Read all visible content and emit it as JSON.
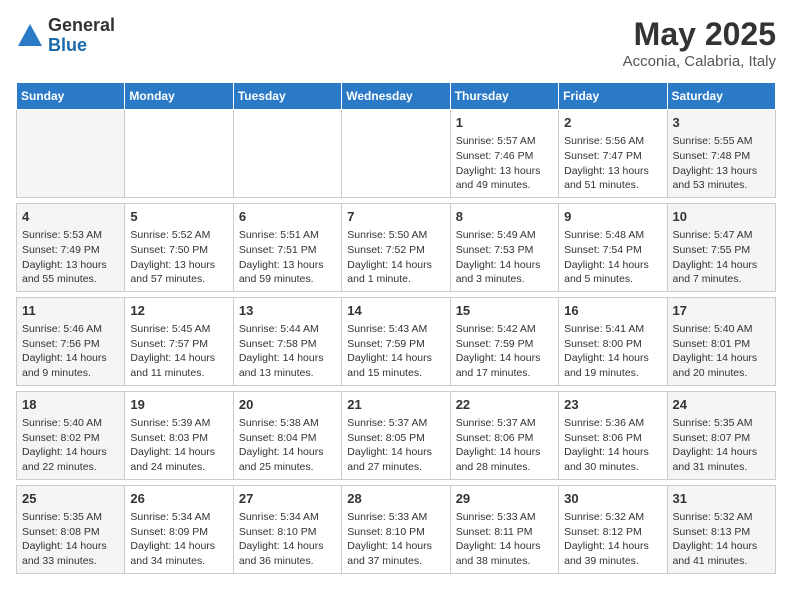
{
  "logo": {
    "general": "General",
    "blue": "Blue"
  },
  "title": "May 2025",
  "subtitle": "Acconia, Calabria, Italy",
  "days_header": [
    "Sunday",
    "Monday",
    "Tuesday",
    "Wednesday",
    "Thursday",
    "Friday",
    "Saturday"
  ],
  "weeks": [
    [
      {
        "num": "",
        "info": ""
      },
      {
        "num": "",
        "info": ""
      },
      {
        "num": "",
        "info": ""
      },
      {
        "num": "",
        "info": ""
      },
      {
        "num": "1",
        "info": "Sunrise: 5:57 AM\nSunset: 7:46 PM\nDaylight: 13 hours\nand 49 minutes."
      },
      {
        "num": "2",
        "info": "Sunrise: 5:56 AM\nSunset: 7:47 PM\nDaylight: 13 hours\nand 51 minutes."
      },
      {
        "num": "3",
        "info": "Sunrise: 5:55 AM\nSunset: 7:48 PM\nDaylight: 13 hours\nand 53 minutes."
      }
    ],
    [
      {
        "num": "4",
        "info": "Sunrise: 5:53 AM\nSunset: 7:49 PM\nDaylight: 13 hours\nand 55 minutes."
      },
      {
        "num": "5",
        "info": "Sunrise: 5:52 AM\nSunset: 7:50 PM\nDaylight: 13 hours\nand 57 minutes."
      },
      {
        "num": "6",
        "info": "Sunrise: 5:51 AM\nSunset: 7:51 PM\nDaylight: 13 hours\nand 59 minutes."
      },
      {
        "num": "7",
        "info": "Sunrise: 5:50 AM\nSunset: 7:52 PM\nDaylight: 14 hours\nand 1 minute."
      },
      {
        "num": "8",
        "info": "Sunrise: 5:49 AM\nSunset: 7:53 PM\nDaylight: 14 hours\nand 3 minutes."
      },
      {
        "num": "9",
        "info": "Sunrise: 5:48 AM\nSunset: 7:54 PM\nDaylight: 14 hours\nand 5 minutes."
      },
      {
        "num": "10",
        "info": "Sunrise: 5:47 AM\nSunset: 7:55 PM\nDaylight: 14 hours\nand 7 minutes."
      }
    ],
    [
      {
        "num": "11",
        "info": "Sunrise: 5:46 AM\nSunset: 7:56 PM\nDaylight: 14 hours\nand 9 minutes."
      },
      {
        "num": "12",
        "info": "Sunrise: 5:45 AM\nSunset: 7:57 PM\nDaylight: 14 hours\nand 11 minutes."
      },
      {
        "num": "13",
        "info": "Sunrise: 5:44 AM\nSunset: 7:58 PM\nDaylight: 14 hours\nand 13 minutes."
      },
      {
        "num": "14",
        "info": "Sunrise: 5:43 AM\nSunset: 7:59 PM\nDaylight: 14 hours\nand 15 minutes."
      },
      {
        "num": "15",
        "info": "Sunrise: 5:42 AM\nSunset: 7:59 PM\nDaylight: 14 hours\nand 17 minutes."
      },
      {
        "num": "16",
        "info": "Sunrise: 5:41 AM\nSunset: 8:00 PM\nDaylight: 14 hours\nand 19 minutes."
      },
      {
        "num": "17",
        "info": "Sunrise: 5:40 AM\nSunset: 8:01 PM\nDaylight: 14 hours\nand 20 minutes."
      }
    ],
    [
      {
        "num": "18",
        "info": "Sunrise: 5:40 AM\nSunset: 8:02 PM\nDaylight: 14 hours\nand 22 minutes."
      },
      {
        "num": "19",
        "info": "Sunrise: 5:39 AM\nSunset: 8:03 PM\nDaylight: 14 hours\nand 24 minutes."
      },
      {
        "num": "20",
        "info": "Sunrise: 5:38 AM\nSunset: 8:04 PM\nDaylight: 14 hours\nand 25 minutes."
      },
      {
        "num": "21",
        "info": "Sunrise: 5:37 AM\nSunset: 8:05 PM\nDaylight: 14 hours\nand 27 minutes."
      },
      {
        "num": "22",
        "info": "Sunrise: 5:37 AM\nSunset: 8:06 PM\nDaylight: 14 hours\nand 28 minutes."
      },
      {
        "num": "23",
        "info": "Sunrise: 5:36 AM\nSunset: 8:06 PM\nDaylight: 14 hours\nand 30 minutes."
      },
      {
        "num": "24",
        "info": "Sunrise: 5:35 AM\nSunset: 8:07 PM\nDaylight: 14 hours\nand 31 minutes."
      }
    ],
    [
      {
        "num": "25",
        "info": "Sunrise: 5:35 AM\nSunset: 8:08 PM\nDaylight: 14 hours\nand 33 minutes."
      },
      {
        "num": "26",
        "info": "Sunrise: 5:34 AM\nSunset: 8:09 PM\nDaylight: 14 hours\nand 34 minutes."
      },
      {
        "num": "27",
        "info": "Sunrise: 5:34 AM\nSunset: 8:10 PM\nDaylight: 14 hours\nand 36 minutes."
      },
      {
        "num": "28",
        "info": "Sunrise: 5:33 AM\nSunset: 8:10 PM\nDaylight: 14 hours\nand 37 minutes."
      },
      {
        "num": "29",
        "info": "Sunrise: 5:33 AM\nSunset: 8:11 PM\nDaylight: 14 hours\nand 38 minutes."
      },
      {
        "num": "30",
        "info": "Sunrise: 5:32 AM\nSunset: 8:12 PM\nDaylight: 14 hours\nand 39 minutes."
      },
      {
        "num": "31",
        "info": "Sunrise: 5:32 AM\nSunset: 8:13 PM\nDaylight: 14 hours\nand 41 minutes."
      }
    ]
  ]
}
